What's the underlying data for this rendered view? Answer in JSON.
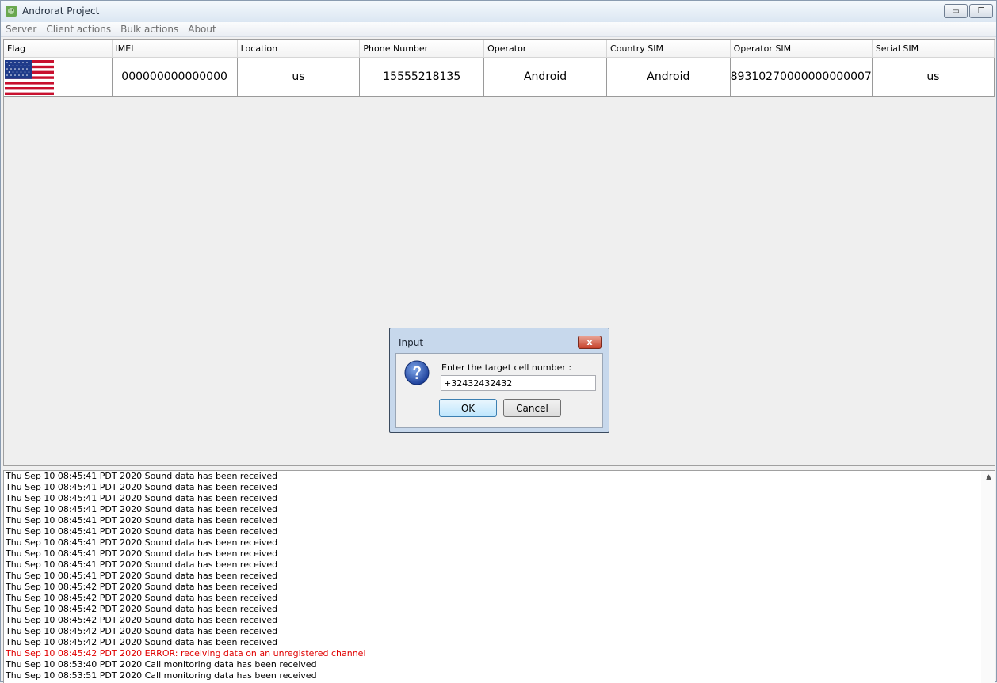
{
  "window": {
    "title": "Androrat Project",
    "controls": {
      "minimize": "▭",
      "restore": "❐"
    }
  },
  "menu": [
    "Server",
    "Client actions",
    "Bulk actions",
    "About"
  ],
  "table": {
    "columns": [
      "Flag",
      "IMEI",
      "Location",
      "Phone Number",
      "Operator",
      "Country SIM",
      "Operator SIM",
      "Serial SIM"
    ],
    "rows": [
      {
        "flag": "us-flag",
        "imei": "000000000000000",
        "location": "us",
        "phone": "15555218135",
        "operator": "Android",
        "country_sim": "Android",
        "operator_sim": "89310270000000000007",
        "serial_sim": "us"
      }
    ]
  },
  "log": {
    "lines": [
      "Thu Sep 10 08:45:41 PDT 2020 Sound data has been received",
      "Thu Sep 10 08:45:41 PDT 2020 Sound data has been received",
      "Thu Sep 10 08:45:41 PDT 2020 Sound data has been received",
      "Thu Sep 10 08:45:41 PDT 2020 Sound data has been received",
      "Thu Sep 10 08:45:41 PDT 2020 Sound data has been received",
      "Thu Sep 10 08:45:41 PDT 2020 Sound data has been received",
      "Thu Sep 10 08:45:41 PDT 2020 Sound data has been received",
      "Thu Sep 10 08:45:41 PDT 2020 Sound data has been received",
      "Thu Sep 10 08:45:41 PDT 2020 Sound data has been received",
      "Thu Sep 10 08:45:41 PDT 2020 Sound data has been received",
      "Thu Sep 10 08:45:42 PDT 2020 Sound data has been received",
      "Thu Sep 10 08:45:42 PDT 2020 Sound data has been received",
      "Thu Sep 10 08:45:42 PDT 2020 Sound data has been received",
      "Thu Sep 10 08:45:42 PDT 2020 Sound data has been received",
      "Thu Sep 10 08:45:42 PDT 2020 Sound data has been received",
      "Thu Sep 10 08:45:42 PDT 2020 Sound data has been received",
      "Thu Sep 10 08:45:42 PDT 2020 ERROR: receiving data on an unregistered channel",
      "Thu Sep 10 08:53:40 PDT 2020 Call monitoring data has been received",
      "Thu Sep 10 08:53:51 PDT 2020 Call monitoring data has been received"
    ],
    "error_index": 16,
    "error_color": "#e00000",
    "scroll_up_icon": "▲"
  },
  "dialog": {
    "title": "Input",
    "close_icon": "x",
    "icon": "question-icon",
    "label": "Enter the target cell number :",
    "input_value": "+32432432432",
    "ok_label": "OK",
    "cancel_label": "Cancel"
  }
}
